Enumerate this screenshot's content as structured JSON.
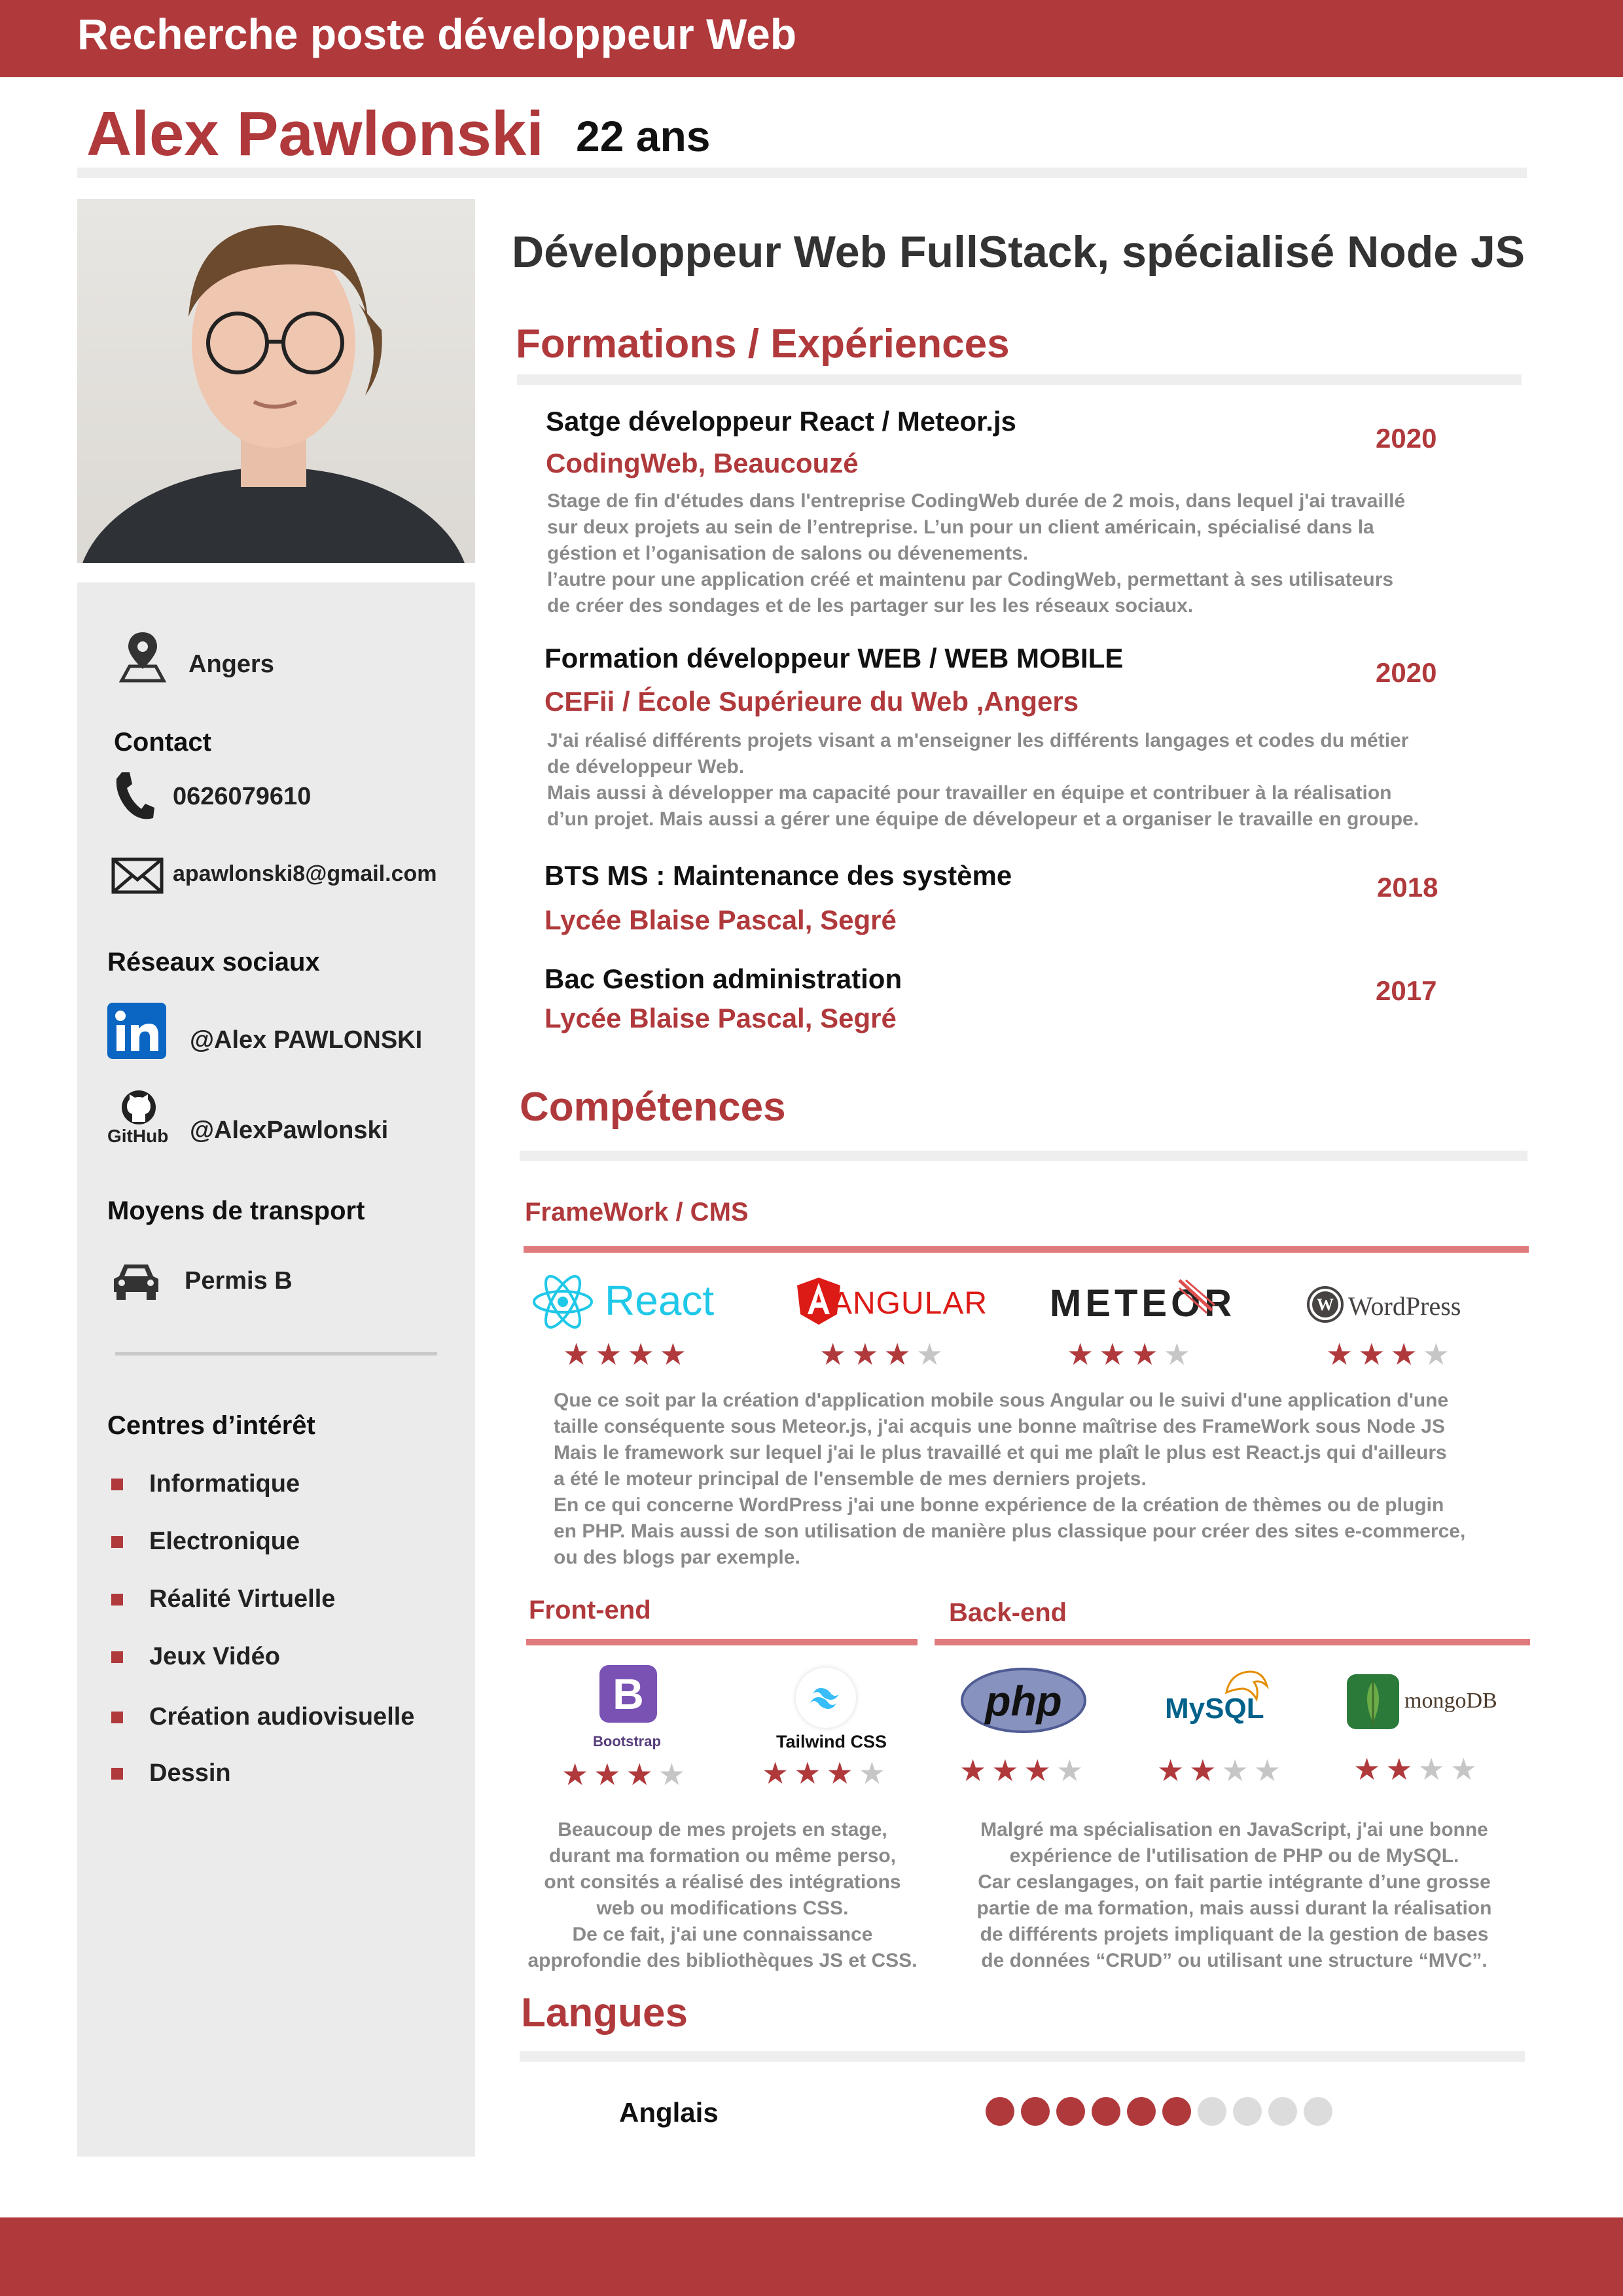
{
  "header": {
    "title": "Recherche poste développeur Web"
  },
  "identity": {
    "name": "Alex Pawlonski",
    "age": "22 ans"
  },
  "headline": "Développeur Web FullStack, spécialisé Node JS",
  "sidebar": {
    "city": "Angers",
    "contact_label": "Contact",
    "phone": "0626079610",
    "email": "apawlonski8@gmail.com",
    "social_label": "Réseaux sociaux",
    "linkedin": "@Alex PAWLONSKI",
    "github_logo_text": "GitHub",
    "github": "@AlexPawlonski",
    "transport_label": "Moyens de transport",
    "transport": "Permis B",
    "interests_label": "Centres d’intérêt",
    "interests": [
      "Informatique",
      "Electronique",
      "Réalité Virtuelle",
      "Jeux Vidéo",
      "Création audiovisuelle",
      "Dessin"
    ]
  },
  "experience": {
    "title": "Formations / Expériences",
    "items": [
      {
        "title": "Satge développeur React / Meteor.js",
        "place": "CodingWeb, Beaucouzé",
        "year": "2020",
        "desc": "Stage de fin d'études dans l'entreprise CodingWeb durée de 2 mois, dans lequel j'ai travaillé\nsur deux projets au sein de l’entreprise. L’un pour un client américain, spécialisé dans la\ngéstion et l’oganisation de salons ou dévenements.\nl’autre pour une application créé et maintenu par CodingWeb, permettant à ses utilisateurs\nde créer des sondages et de les partager sur les les réseaux sociaux."
      },
      {
        "title": "Formation développeur WEB / WEB MOBILE",
        "place": "CEFii / École Supérieure du Web ,Angers",
        "year": "2020",
        "desc": "J'ai réalisé différents projets visant a m'enseigner les différents langages et codes du métier\nde développeur Web.\nMais aussi à développer ma capacité pour travailler en équipe et contribuer à la réalisation\nd’un projet. Mais aussi a gérer une équipe de dévelopeur et a organiser le travaille en groupe."
      },
      {
        "title": "BTS MS : Maintenance des système",
        "place": "Lycée Blaise Pascal, Segré",
        "year": "2018",
        "desc": ""
      },
      {
        "title": "Bac Gestion administration",
        "place": "Lycée Blaise Pascal, Segré",
        "year": "2017",
        "desc": ""
      }
    ]
  },
  "skills": {
    "title": "Compétences",
    "framework_title": "FrameWork / CMS",
    "frameworks": [
      {
        "name": "React",
        "rating": 4
      },
      {
        "name": "ANGULAR",
        "rating": 3
      },
      {
        "name": "METEOR",
        "rating": 3
      },
      {
        "name": "WordPress",
        "rating": 3
      }
    ],
    "framework_desc": "Que ce soit par la création d'application mobile sous Angular ou le suivi d'une application d'une\ntaille conséquente sous Meteor.js,  j'ai acquis une bonne maîtrise des FrameWork sous Node JS\nMais le framework sur lequel j'ai le plus travaillé et qui me plaît le plus est React.js qui d'ailleurs\na été le moteur principal de l'ensemble de mes derniers projets.\nEn ce qui concerne WordPress j'ai une bonne expérience de la création de thèmes ou de plugin\nen PHP. Mais aussi de son utilisation de manière plus classique pour créer des sites e-commerce,\nou des blogs par exemple.",
    "front_title": "Front-end",
    "front": [
      {
        "name": "Bootstrap",
        "rating": 3
      },
      {
        "name": "Tailwind CSS",
        "rating": 3
      }
    ],
    "front_desc": "Beaucoup de mes projets en stage,\ndurant ma formation ou même perso,\nont consités a réalisé des intégrations\nweb ou modifications CSS.\nDe ce fait, j'ai une connaissance\napprofondie des bibliothèques JS et CSS.",
    "back_title": "Back-end",
    "back": [
      {
        "name": "php",
        "rating": 3
      },
      {
        "name": "MySQL",
        "rating": 2
      },
      {
        "name": "mongoDB",
        "rating": 2
      }
    ],
    "back_desc": "Malgré ma spécialisation en JavaScript, j'ai une bonne\nexpérience de l'utilisation de PHP ou de MySQL.\nCar ceslangages, on fait partie intégrante d’une grosse\npartie de ma formation,  mais aussi durant la réalisation\nde différents projets impliquant de la gestion de bases\nde données “CRUD” ou utilisant une structure “MVC”."
  },
  "languages": {
    "title": "Langues",
    "items": [
      {
        "name": "Anglais",
        "level": 6,
        "max": 10
      }
    ]
  },
  "colors": {
    "accent": "#b0393c",
    "sidebar": "#ebebeb",
    "muted": "#8a8a8a"
  }
}
